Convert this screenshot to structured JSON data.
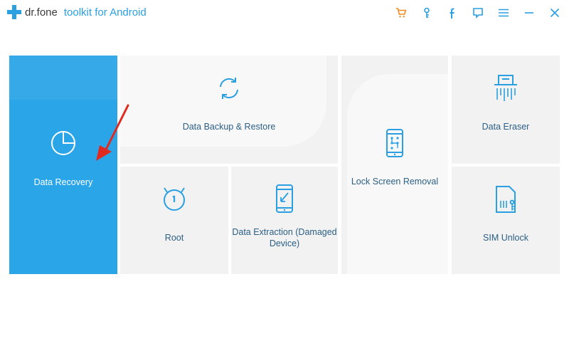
{
  "app": {
    "name": "dr.fone",
    "subtitle": "toolkit for Android"
  },
  "toolbar": {
    "icons": [
      "cart-icon",
      "key-icon",
      "facebook-icon",
      "chat-icon",
      "menu-icon",
      "minimize-icon",
      "close-icon"
    ],
    "cart_color": "#f08a1c",
    "icon_color": "#2a9fe2"
  },
  "tiles": {
    "data_recovery": "Data Recovery",
    "data_backup_restore": "Data Backup & Restore",
    "lock_screen_removal": "Lock Screen Removal",
    "data_eraser": "Data Eraser",
    "root": "Root",
    "data_extraction_line1": "Data Extraction (Damaged",
    "data_extraction_line2": "Device)",
    "sim_unlock": "SIM Unlock"
  },
  "colors": {
    "accent": "#2aa5e8",
    "tile_bg": "#f2f2f2",
    "label": "#2b5f84",
    "arrow": "#e02a1f"
  }
}
